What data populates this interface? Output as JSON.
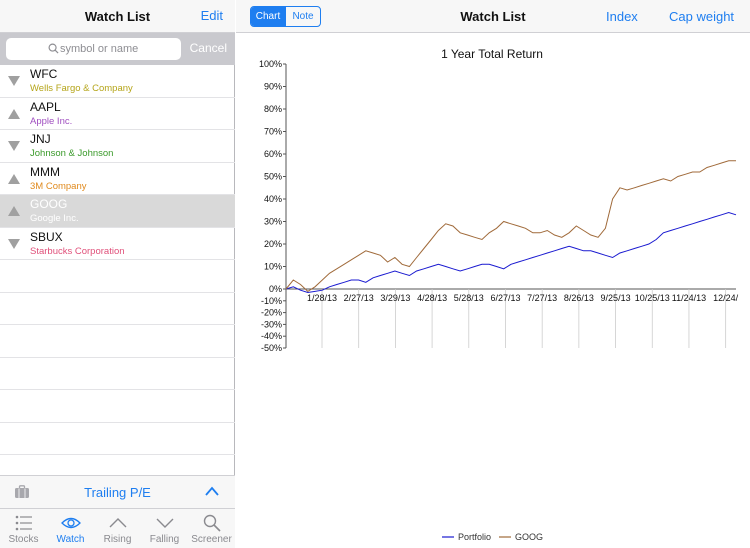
{
  "left_header": {
    "title": "Watch List",
    "edit_label": "Edit"
  },
  "search": {
    "placeholder": "symbol or name",
    "cancel_label": "Cancel"
  },
  "watchlist": [
    {
      "symbol": "WFC",
      "name": "Wells Fargo & Company",
      "trend": "down",
      "name_color": "#b5a51a"
    },
    {
      "symbol": "AAPL",
      "name": "Apple Inc.",
      "trend": "up",
      "name_color": "#a04fc0"
    },
    {
      "symbol": "JNJ",
      "name": "Johnson & Johnson",
      "trend": "down",
      "name_color": "#3a9a2a"
    },
    {
      "symbol": "MMM",
      "name": "3M Company",
      "trend": "up",
      "name_color": "#e08a1e"
    },
    {
      "symbol": "GOOG",
      "name": "Google Inc.",
      "trend": "up",
      "name_color": "#ffffff",
      "selected": true
    },
    {
      "symbol": "SBUX",
      "name": "Starbucks Corporation",
      "trend": "down",
      "name_color": "#e0507a"
    }
  ],
  "sort_bar": {
    "label": "Trailing P/E",
    "bag_icon": "briefcase-icon",
    "toggle_icon": "chevron-up-icon"
  },
  "tabs": [
    {
      "label": "Stocks",
      "icon": "list-icon"
    },
    {
      "label": "Watch",
      "icon": "eye-icon",
      "active": true
    },
    {
      "label": "Rising",
      "icon": "chevron-up-icon"
    },
    {
      "label": "Falling",
      "icon": "chevron-down-icon"
    },
    {
      "label": "Screener",
      "icon": "magnifier-icon"
    }
  ],
  "right_header": {
    "segments": [
      "Chart",
      "Note"
    ],
    "active_segment": "Chart",
    "title": "Watch List",
    "index_label": "Index",
    "cap_weight_label": "Cap weight"
  },
  "colors": {
    "accent": "#1e7ef0",
    "portfolio": "#1a1ad0",
    "goog": "#a06a3a"
  },
  "chart_data": {
    "type": "line",
    "title": "1 Year Total Return",
    "y_ticks": [
      "100%",
      "90%",
      "80%",
      "70%",
      "60%",
      "50%",
      "40%",
      "30%",
      "20%",
      "10%",
      "0%",
      "-10%",
      "-20%",
      "-30%",
      "-40%",
      "-50%"
    ],
    "x_ticks": [
      "1/28/13",
      "2/27/13",
      "3/29/13",
      "4/28/13",
      "5/28/13",
      "6/27/13",
      "7/27/13",
      "8/26/13",
      "9/25/13",
      "10/25/13",
      "11/24/13",
      "12/24/"
    ],
    "series": [
      {
        "name": "Portfolio",
        "color": "#1a1ad0",
        "values": [
          0,
          1,
          -1,
          -3,
          -2,
          -1,
          1,
          2,
          3,
          4,
          4,
          3,
          5,
          6,
          7,
          8,
          7,
          6,
          8,
          9,
          10,
          11,
          10,
          9,
          8,
          9,
          10,
          11,
          11,
          10,
          9,
          11,
          12,
          13,
          14,
          15,
          16,
          17,
          18,
          19,
          18,
          17,
          17,
          16,
          15,
          14,
          16,
          17,
          18,
          19,
          20,
          22,
          25,
          26,
          27,
          28,
          29,
          30,
          31,
          32,
          33,
          34,
          33
        ]
      },
      {
        "name": "GOOG",
        "color": "#a06a3a",
        "values": [
          0,
          4,
          2,
          -2,
          1,
          4,
          7,
          9,
          11,
          13,
          15,
          17,
          16,
          15,
          12,
          14,
          11,
          10,
          14,
          18,
          22,
          26,
          29,
          28,
          25,
          24,
          23,
          22,
          25,
          27,
          30,
          29,
          28,
          27,
          25,
          25,
          26,
          24,
          23,
          25,
          28,
          26,
          24,
          23,
          27,
          40,
          45,
          44,
          45,
          46,
          47,
          48,
          49,
          48,
          50,
          51,
          52,
          52,
          54,
          55,
          56,
          57,
          57
        ]
      }
    ]
  }
}
